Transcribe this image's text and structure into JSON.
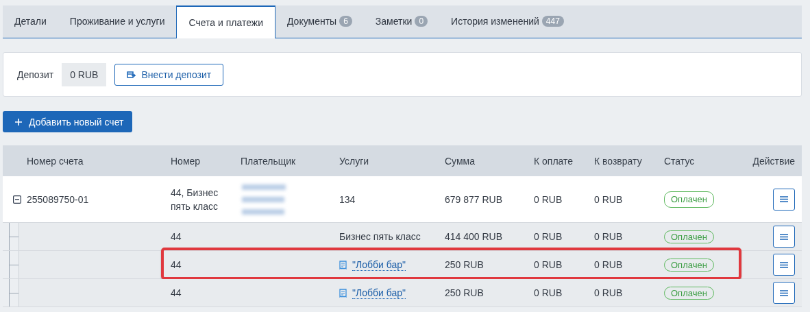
{
  "tabs": [
    {
      "label": "Детали",
      "selected": false
    },
    {
      "label": "Проживание и услуги",
      "selected": false
    },
    {
      "label": "Счета и платежи",
      "selected": true
    },
    {
      "label": "Документы",
      "badge": "6",
      "selected": false
    },
    {
      "label": "Заметки",
      "badge": "0",
      "selected": false
    },
    {
      "label": "История изменений",
      "badge": "447",
      "selected": false
    }
  ],
  "deposit": {
    "label": "Депозит",
    "value": "0 RUB",
    "button": "Внести депозит"
  },
  "add_button": "Добавить новый счет",
  "table": {
    "columns": [
      "Номер счета",
      "Номер",
      "Плательщик",
      "Услуги",
      "Сумма",
      "К оплате",
      "К возврату",
      "Статус",
      "Действие"
    ],
    "rows": [
      {
        "account": "255089750-01",
        "expanded": true,
        "number": "44, Бизнес пять класс",
        "services": {
          "kind": "text",
          "text": "134"
        },
        "amount": "679 877 RUB",
        "to_pay": "0 RUB",
        "refund": "0 RUB",
        "status": "Оплачен",
        "children": [
          {
            "number": "44",
            "services": {
              "kind": "text",
              "text": "Бизнес пять класс"
            },
            "amount": "414 400 RUB",
            "to_pay": "0 RUB",
            "refund": "0 RUB",
            "status": "Оплачен",
            "highlighted": false
          },
          {
            "number": "44",
            "services": {
              "kind": "link",
              "text": "\"Лобби бар\""
            },
            "amount": "250 RUB",
            "to_pay": "0 RUB",
            "refund": "0 RUB",
            "status": "Оплачен",
            "highlighted": true
          },
          {
            "number": "44",
            "services": {
              "kind": "link",
              "text": "\"Лобби бар\""
            },
            "amount": "250 RUB",
            "to_pay": "0 RUB",
            "refund": "0 RUB",
            "status": "Оплачен",
            "highlighted": false
          }
        ]
      }
    ]
  }
}
